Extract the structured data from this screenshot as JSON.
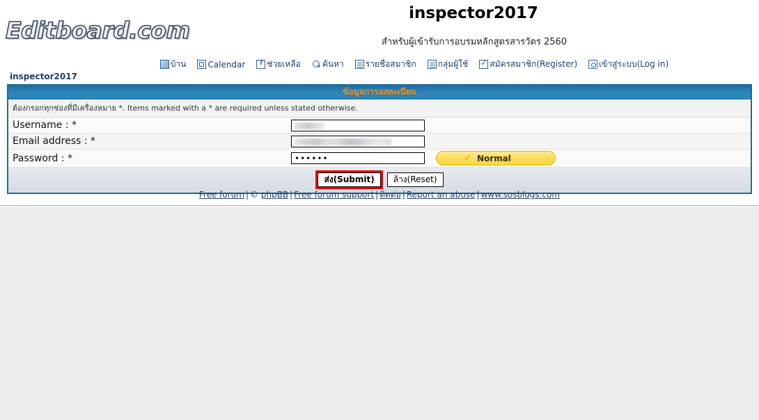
{
  "brand": {
    "logo_text": "Editboard.com"
  },
  "header": {
    "site_title": "inspector2017",
    "site_subtitle": "สำหรับผู้เข้ารับการอบรมหลักสูตรสารวัตร 2560"
  },
  "nav": {
    "items": [
      {
        "label": "บ้าน",
        "icon": "home-icon"
      },
      {
        "label": "Calendar",
        "icon": "calendar-icon"
      },
      {
        "label": "ช่วยเหลือ",
        "icon": "help-icon"
      },
      {
        "label": "ค้นหา",
        "icon": "search-icon"
      },
      {
        "label": "รายชื่อสมาชิก",
        "icon": "memberlist-icon"
      },
      {
        "label": "กลุ่มผู้ใช้",
        "icon": "usergroups-icon"
      },
      {
        "label": "สมัครสมาชิก(Register)",
        "icon": "register-icon"
      },
      {
        "label": "เข้าสู่ระบบ(Log in)",
        "icon": "login-icon"
      }
    ]
  },
  "breadcrumb": {
    "text": "inspector2017"
  },
  "form": {
    "panel_title": "ข้อมูลการลงทะเบียน",
    "note": "ต้องกรอกทุกช่องที่มีเครื่องหมาย *. Items marked with a * are required unless stated otherwise.",
    "fields": [
      {
        "label": "Username : *",
        "value": "",
        "placeholder": ""
      },
      {
        "label": "Email address : *",
        "value": "",
        "placeholder": ""
      },
      {
        "label": "Password : *",
        "value": "••••••",
        "placeholder": ""
      }
    ],
    "password_strength": {
      "label": "Normal",
      "icon": "check-icon",
      "color": "#fbd93f"
    },
    "buttons": {
      "submit_label": "ส่ง(Submit)",
      "reset_label": "ล้าง(Reset)",
      "submit_highlight_color": "#e60000"
    }
  },
  "footer": {
    "links": [
      "Free forum",
      "phpBB",
      "Free forum support",
      "ติดต่อ",
      "Report an abuse",
      "www.sosblogs.com"
    ],
    "copyright_mark": "©",
    "separator": "|"
  },
  "colors": {
    "panel_border": "#1a6c9c",
    "panel_header_blue": "#2f86ba",
    "panel_title_orange": "#f5951e",
    "link_blue": "#1d3f6e"
  }
}
